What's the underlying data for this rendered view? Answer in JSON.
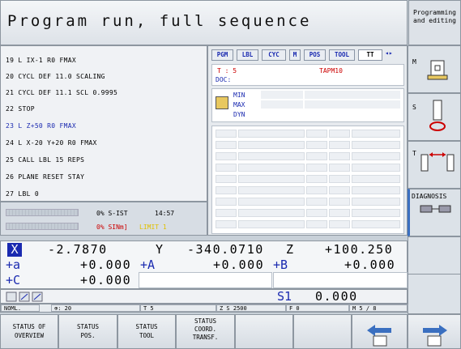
{
  "header": {
    "title": "Program run, full sequence",
    "secondary_mode": [
      "Programming",
      "and editing"
    ]
  },
  "program": {
    "lines": [
      "19 L IX-1 R0 FMAX",
      "20 CYCL DEF 11.0 SCALING",
      "21 CYCL DEF 11.1 SCL 0.9995",
      "22 STOP",
      "23 L  Z+50 R0 FMAX",
      "24 L  X-20  Y+20 R0 FMAX",
      "25 CALL LBL 15 REPS",
      "26 PLANE RESET STAY",
      "27 LBL 0"
    ],
    "active_index": 4,
    "spindle_ist": {
      "pct": "0% S-IST",
      "time": "14:57"
    },
    "spindle_nm": {
      "pct": "0% SINm]",
      "limit": "LIMIT 1"
    }
  },
  "status": {
    "tabs": [
      "PGM",
      "LBL",
      "CYC",
      "M",
      "POS",
      "TOOL",
      "TT"
    ],
    "selected_tab": "TT",
    "tool_line": {
      "t_label": "T : 5",
      "tool_name": "TAPM10",
      "doc": "DOC:"
    },
    "life": [
      "MIN",
      "MAX",
      "DYN"
    ]
  },
  "right_softkeys": {
    "m_label": "M",
    "s_label": "S",
    "t_label": "T",
    "diagnosis": "DIAGNOSIS"
  },
  "position": {
    "rows": [
      [
        {
          "axis": "X",
          "value": "-2.7870"
        },
        {
          "axis": "Y",
          "value": "-340.0710"
        },
        {
          "axis": "Z",
          "value": "+100.250"
        }
      ],
      [
        {
          "axis": "+a",
          "value": "+0.000"
        },
        {
          "axis": "+A",
          "value": "+0.000"
        },
        {
          "axis": "+B",
          "value": "+0.000"
        }
      ],
      [
        {
          "axis": "+C",
          "value": "+0.000"
        }
      ]
    ],
    "spindle": {
      "label": "S1",
      "value": "0.000"
    }
  },
  "statusbar": {
    "mode": "NOML.",
    "f": "⊕: 20",
    "tool": "T 5",
    "zs": "Z S 2500",
    "feed": "F 0",
    "m": "M 5 / 8"
  },
  "bottom_softkeys": [
    [
      "STATUS OF",
      "OVERVIEW"
    ],
    [
      "STATUS",
      "POS."
    ],
    [
      "STATUS",
      "TOOL"
    ],
    [
      "STATUS",
      "COORD.",
      "TRANSF."
    ]
  ]
}
